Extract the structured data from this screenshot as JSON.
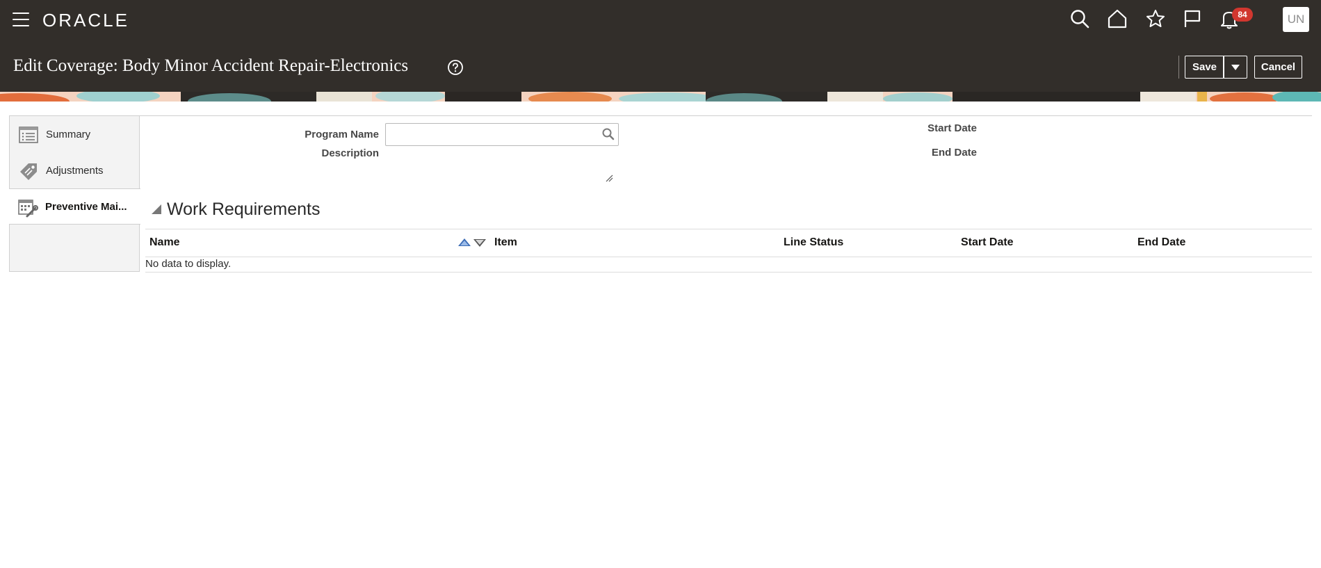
{
  "header": {
    "logo": "ORACLE",
    "notification_count": "84",
    "avatar_initials": "UN",
    "page_title": "Edit Coverage: Body Minor Accident Repair-Electronics"
  },
  "actions": {
    "save_label": "Save",
    "cancel_label": "Cancel"
  },
  "sidebar": {
    "items": [
      {
        "label": "Summary",
        "icon": "list-icon"
      },
      {
        "label": "Adjustments",
        "icon": "tag-icon"
      },
      {
        "label": "Preventive Mai...",
        "icon": "calendar-wrench-icon",
        "active": true
      }
    ]
  },
  "form": {
    "program_name_label": "Program Name",
    "program_name_value": "",
    "description_label": "Description",
    "start_date_label": "Start Date",
    "end_date_label": "End Date"
  },
  "work_requirements": {
    "title": "Work Requirements",
    "columns": [
      "Name",
      "Item",
      "Line Status",
      "Start Date",
      "End Date"
    ],
    "empty_message": "No data to display."
  },
  "colors": {
    "header_bg": "#322e2a",
    "badge": "#d1372f",
    "sort_asc": "#3a6bb5"
  }
}
